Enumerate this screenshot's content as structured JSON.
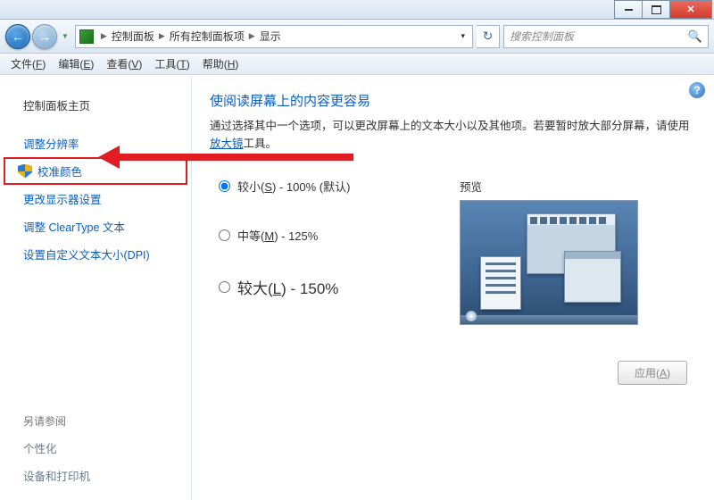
{
  "addrbar": {
    "crumbs": [
      "控制面板",
      "所有控制面板项",
      "显示"
    ]
  },
  "search": {
    "placeholder": "搜索控制面板"
  },
  "menu": {
    "file": "文件(",
    "file_k": "F",
    "file_e": ")",
    "edit": "编辑(",
    "edit_k": "E",
    "edit_e": ")",
    "view": "查看(",
    "view_k": "V",
    "view_e": ")",
    "tools": "工具(",
    "tools_k": "T",
    "tools_e": ")",
    "help": "帮助(",
    "help_k": "H",
    "help_e": ")"
  },
  "sidebar": {
    "home": "控制面板主页",
    "items": [
      "调整分辨率",
      "校准颜色",
      "更改显示器设置",
      "调整 ClearType 文本",
      "设置自定义文本大小(DPI)"
    ],
    "see_also": "另请参阅",
    "secondary": [
      "个性化",
      "设备和打印机"
    ]
  },
  "main": {
    "title": "使阅读屏幕上的内容更容易",
    "desc_pre": "通过选择其中一个选项，可以更改屏幕上的文本大小以及其他项。若要暂时放大部分屏幕，请使用",
    "desc_link": "放大镜",
    "desc_post": "工具。",
    "opt_small_pre": "较小(",
    "opt_small_k": "S",
    "opt_small_post": ") - 100% (默认)",
    "opt_med_pre": "中等(",
    "opt_med_k": "M",
    "opt_med_post": ") - 125%",
    "opt_lg_pre": "较大(",
    "opt_lg_k": "L",
    "opt_lg_post": ") - 150%",
    "preview_label": "预览",
    "apply_pre": "应用(",
    "apply_k": "A",
    "apply_post": ")"
  }
}
